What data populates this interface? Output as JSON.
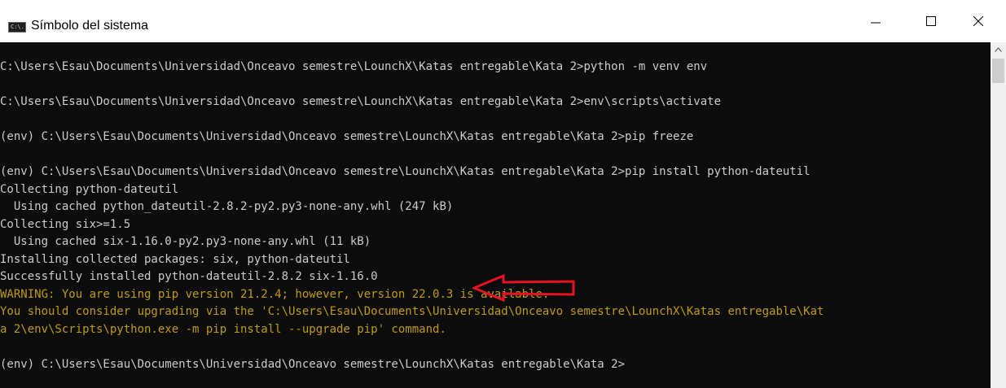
{
  "window": {
    "title": "Símbolo del sistema",
    "icon": "cmd-icon",
    "icon_text": "C:\\."
  },
  "controls": {
    "minimize_icon": "minimize-icon",
    "maximize_icon": "maximize-icon",
    "close_icon": "close-icon"
  },
  "colors": {
    "terminal_bg": "#0c0c0c",
    "text": "#cccccc",
    "warning": "#c19c00",
    "annotation_arrow": "#e81123"
  },
  "terminal": {
    "lines": [
      {
        "text": "C:\\Users\\Esau\\Documents\\Universidad\\Onceavo semestre\\LounchX\\Katas entregable\\Kata 2>python -m venv env",
        "color": "gray"
      },
      {
        "text": "",
        "color": "gray"
      },
      {
        "text": "C:\\Users\\Esau\\Documents\\Universidad\\Onceavo semestre\\LounchX\\Katas entregable\\Kata 2>env\\scripts\\activate",
        "color": "gray"
      },
      {
        "text": "",
        "color": "gray"
      },
      {
        "text": "(env) C:\\Users\\Esau\\Documents\\Universidad\\Onceavo semestre\\LounchX\\Katas entregable\\Kata 2>pip freeze",
        "color": "gray"
      },
      {
        "text": "",
        "color": "gray"
      },
      {
        "text": "(env) C:\\Users\\Esau\\Documents\\Universidad\\Onceavo semestre\\LounchX\\Katas entregable\\Kata 2>pip install python-dateutil",
        "color": "gray"
      },
      {
        "text": "Collecting python-dateutil",
        "color": "gray"
      },
      {
        "text": "  Using cached python_dateutil-2.8.2-py2.py3-none-any.whl (247 kB)",
        "color": "gray"
      },
      {
        "text": "Collecting six>=1.5",
        "color": "gray"
      },
      {
        "text": "  Using cached six-1.16.0-py2.py3-none-any.whl (11 kB)",
        "color": "gray"
      },
      {
        "text": "Installing collected packages: six, python-dateutil",
        "color": "gray"
      },
      {
        "text": "Successfully installed python-dateutil-2.8.2 six-1.16.0",
        "color": "gray"
      },
      {
        "text": "WARNING: You are using pip version 21.2.4; however, version 22.0.3 is available.",
        "color": "yellow"
      },
      {
        "text": "You should consider upgrading via the 'C:\\Users\\Esau\\Documents\\Universidad\\Onceavo semestre\\LounchX\\Katas entregable\\Kat",
        "color": "yellow"
      },
      {
        "text": "a 2\\env\\Scripts\\python.exe -m pip install --upgrade pip' command.",
        "color": "yellow"
      },
      {
        "text": "",
        "color": "gray"
      },
      {
        "text": "(env) C:\\Users\\Esau\\Documents\\Universidad\\Onceavo semestre\\LounchX\\Katas entregable\\Kata 2>",
        "color": "gray"
      }
    ]
  }
}
